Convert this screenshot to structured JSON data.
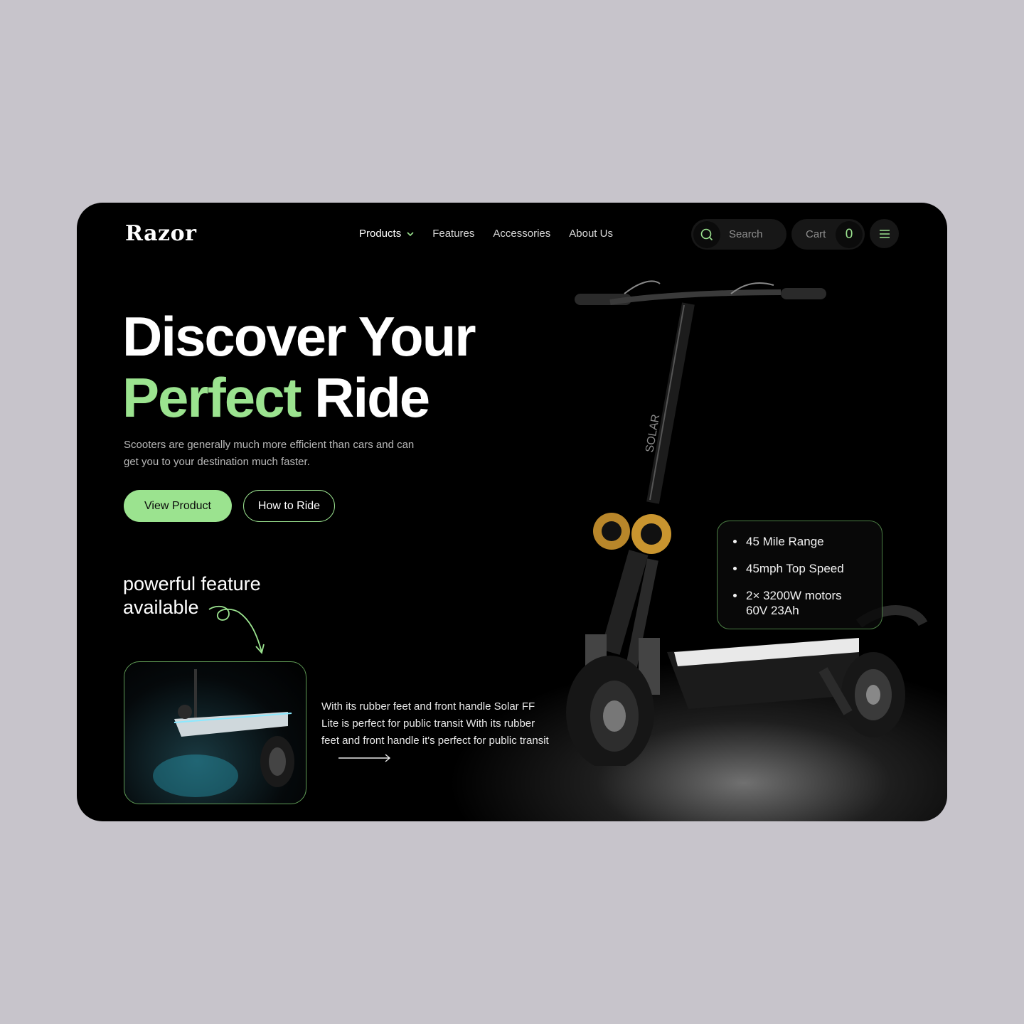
{
  "brand": {
    "logo": "Razor"
  },
  "nav": {
    "items": [
      {
        "label": "Products",
        "active": true,
        "has_dropdown": true
      },
      {
        "label": "Features"
      },
      {
        "label": "Accessories"
      },
      {
        "label": "About Us"
      }
    ]
  },
  "search": {
    "placeholder": "Search",
    "icon": "search-icon"
  },
  "cart": {
    "label": "Cart",
    "count": "0"
  },
  "menu": {
    "icon": "hamburger-menu-icon"
  },
  "hero": {
    "title_line1": "Discover Your",
    "title_line2_green": "Perfect",
    "title_line2_rest": "Ride",
    "subtitle": "Scooters are generally much more efficient than cars and can get you to your destination much faster.",
    "primary_button": "View Product",
    "secondary_button": "How to Ride"
  },
  "feature": {
    "title_line1": "powerful feature",
    "title_line2": "available",
    "description": "With its rubber feet and front handle Solar FF Lite is perfect for public transit With its rubber feet and front handle it's perfect for public transit"
  },
  "specs": [
    "45 Mile Range",
    "45mph Top Speed",
    "2× 3200W motors 60V 23Ah"
  ],
  "colors": {
    "accent": "#9be38f",
    "background": "#000000",
    "page": "#c7c4cb"
  }
}
